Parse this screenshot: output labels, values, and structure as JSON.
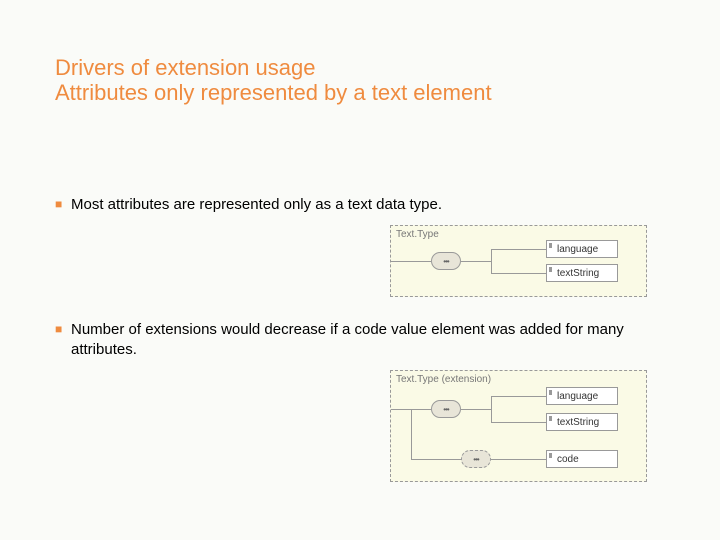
{
  "title": {
    "line1": "Drivers of extension usage",
    "line2": "Attributes only represented by a text element"
  },
  "bullets": {
    "b1": "Most attributes are represented only as a text data type.",
    "b2": "Number of extensions would decrease if a code value element was added for many attributes."
  },
  "diagrams": {
    "d1": {
      "label": "Text.Type",
      "seq": "•••",
      "elements": [
        "language",
        "textString"
      ]
    },
    "d2": {
      "label": "Text.Type (extension)",
      "seq": "•••",
      "elements": [
        "language",
        "textString",
        "code"
      ]
    }
  },
  "colors": {
    "accent": "#ef8b3f",
    "diagram_bg": "#fafae6"
  }
}
